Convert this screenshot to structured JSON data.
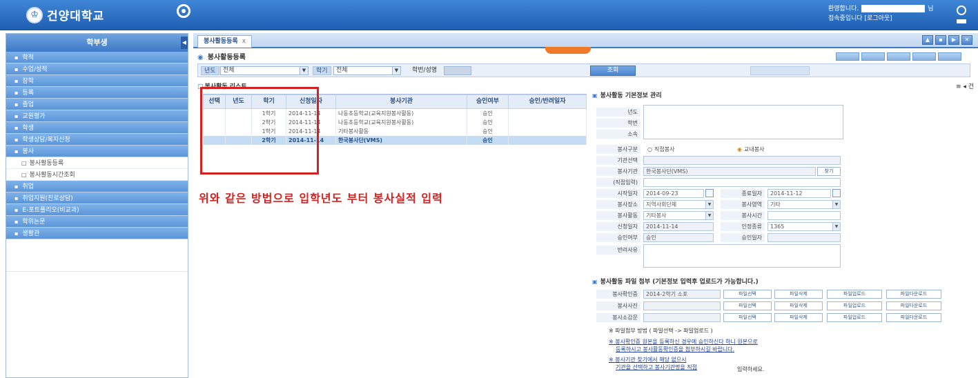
{
  "header": {
    "logo_mark": "♔",
    "logo_text": "건양대학교",
    "user_line1": "환영합니다.",
    "user_suffix": "님",
    "user_line2": "접속중입니다 [로그아웃]"
  },
  "sidebar": {
    "title": "학부생",
    "collapse": "◀",
    "items": [
      "학적",
      "수업/성적",
      "장학",
      "등록",
      "졸업",
      "교원평가",
      "학생",
      "학생상담/복지신청",
      "봉사"
    ],
    "sub_items": [
      "봉사활동등록",
      "봉사활동시간조회"
    ],
    "items_after": [
      "취업",
      "취업지원(진로상담)",
      "E-포트폴리오(비교과)",
      "학위논문",
      "생활관"
    ]
  },
  "main": {
    "tab_label": "봉사활동등록",
    "tab_close": "x",
    "window_buttons": [
      "▲",
      "▪",
      "▶",
      "✕"
    ],
    "page_title": "봉사활동등록",
    "action_buttons": [
      "",
      "",
      "",
      "",
      ""
    ],
    "search": {
      "year_label": "년도",
      "year_value": "전체",
      "term_label": "학기",
      "term_value": "전체",
      "student_label": "학번/성명",
      "search_button": "조회"
    },
    "list_title": "봉사활동 리스트",
    "paging": "≡ ◂ 건"
  },
  "grid": {
    "columns": [
      "선택",
      "년도",
      "학기",
      "신청일자",
      "봉사기관",
      "승인여부",
      "승인/반려일자"
    ],
    "rows": [
      [
        "",
        "",
        "1학기",
        "2014-11-14",
        "나동초등학교(교육지원봉사활동)",
        "승인",
        ""
      ],
      [
        "",
        "",
        "2학기",
        "2014-11-14",
        "나동초등학교(교육지원봉사활동)",
        "승인",
        ""
      ],
      [
        "",
        "",
        "1학기",
        "2014-11-14",
        "기타봉사활동",
        "승인",
        ""
      ],
      [
        "",
        "",
        "2학기",
        "2014-11-14",
        "한국봉사단(VMS)",
        "승인",
        ""
      ]
    ],
    "selected_row": 3
  },
  "annotation_text": "위와 같은 방법으로 입학년도 부터 봉사실적 입력",
  "basic_info": {
    "section_title": "봉사활동 기본정보 관리",
    "labels": {
      "year": "년도",
      "student_id": "학번",
      "affiliation": "소속",
      "service_type": "봉사구분",
      "org_select": "기관선택",
      "org_name": "봉사기관",
      "career_input": "(직접입력)",
      "start_date": "시작일자",
      "end_date": "종료일자",
      "place": "봉사장소",
      "category": "봉사영역",
      "activity": "봉사활동",
      "hours": "봉사시간",
      "apply_date": "신청일자",
      "recognized": "인정종류",
      "approval": "승인여부",
      "approval_date": "승인일자",
      "reject_reason": "반려사유"
    },
    "values": {
      "service_direct": "직접봉사",
      "service_school": "교내봉사",
      "org_name": "한국봉사단(VMS)",
      "start_date": "2014-09-23",
      "end_date": "2014-11-12",
      "place": "지역사회단체",
      "category": "기타",
      "activity": "기타봉사",
      "apply_date": "2014-11-14",
      "recognized": "1365",
      "approval": "승인"
    },
    "search_btn": "찾기"
  },
  "attach": {
    "section_title": "봉사활동 파일 첨부 (기본정보 입력후 업로드가 가능합니다.)",
    "rows": [
      {
        "label": "봉사확인증",
        "file": "2014-2학기 소포"
      },
      {
        "label": "봉사사진",
        "file": ""
      },
      {
        "label": "봉사소감문",
        "file": ""
      }
    ],
    "btn_select": "파일선택",
    "btn_delete": "파일삭제",
    "btn_upload": "파일업로드",
    "btn_download": "파일다운로드",
    "note1": "※ 파일첨부 방법 ( 파일선택 -> 파일업로드 )",
    "note2a": "※ 봉사확인증 원본을 등록하신 경우에 승인하신다 하니 원본으로",
    "note2b": "등록하시고 봉사활동확인증을 첨부하시길 바랍니다.",
    "note3a": "※ 봉사기관 찾기에서 해당 없으시",
    "note3b": "기관을 선택하고 봉사기관명을 직접",
    "note3c": "입력하세요."
  }
}
